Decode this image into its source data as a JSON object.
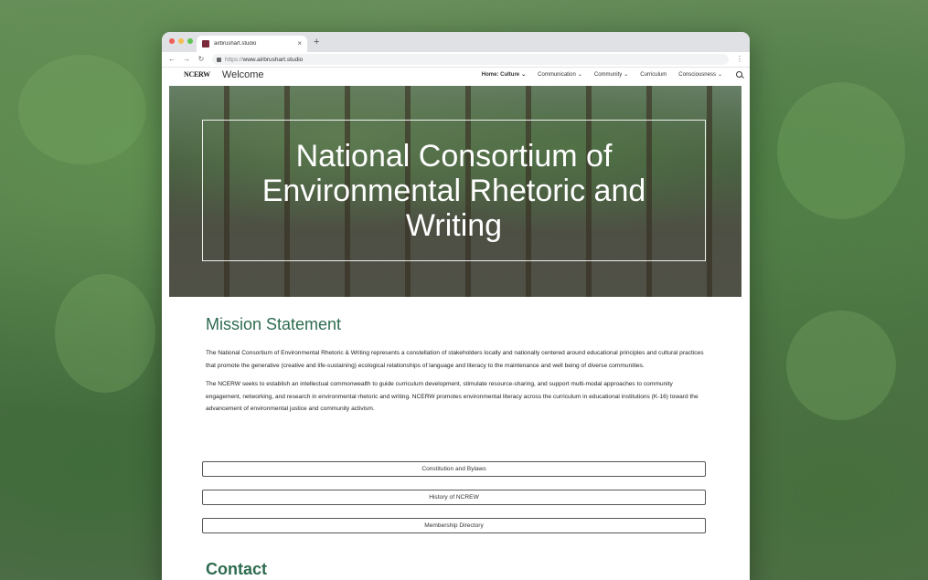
{
  "browser": {
    "tab_title": "airbrushart.studio",
    "tab_close": "×",
    "new_tab": "+",
    "url_protocol": "https://",
    "url_host": "www.airbrushart.studio",
    "back": "←",
    "forward": "→",
    "reload": "↻",
    "menu": "⋮"
  },
  "site": {
    "logo": "NCERW",
    "title": "Welcome",
    "nav": [
      {
        "label": "Home: Culture",
        "chevron": "⌄"
      },
      {
        "label": "Communication",
        "chevron": "⌄"
      },
      {
        "label": "Community",
        "chevron": "⌄"
      },
      {
        "label": "Curriculum"
      },
      {
        "label": "Consciousness",
        "chevron": "⌄"
      }
    ]
  },
  "hero": {
    "title": "National Consortium of Environmental Rhetoric and Writing"
  },
  "mission": {
    "heading": "Mission Statement",
    "paragraphs": [
      "The National Consortium of Environmental Rhetoric & Writing represents a constellation of stakeholders locally and nationally centered around educational principles and cultural practices that promote the generative (creative and life-sustaining) ecological relationships of language and literacy to the maintenance and well being of diverse communities.",
      "The NCERW seeks to establish an intellectual commonwealth to guide curriculum development, stimulate resource-sharing, and support multi-modal approaches to community engagement, networking, and research in environmental rhetoric and writing. NCERW promotes environmental literacy across the curriculum in educational institutions (K-16) toward the advancement of environmental justice and community activism."
    ]
  },
  "buttons": {
    "constitution": "Constitution and Bylaws",
    "history": "History of NCREW",
    "membership": "Membership Directory"
  },
  "contact": {
    "heading": "Contact"
  },
  "colors": {
    "accent": "#2e6b4f"
  }
}
